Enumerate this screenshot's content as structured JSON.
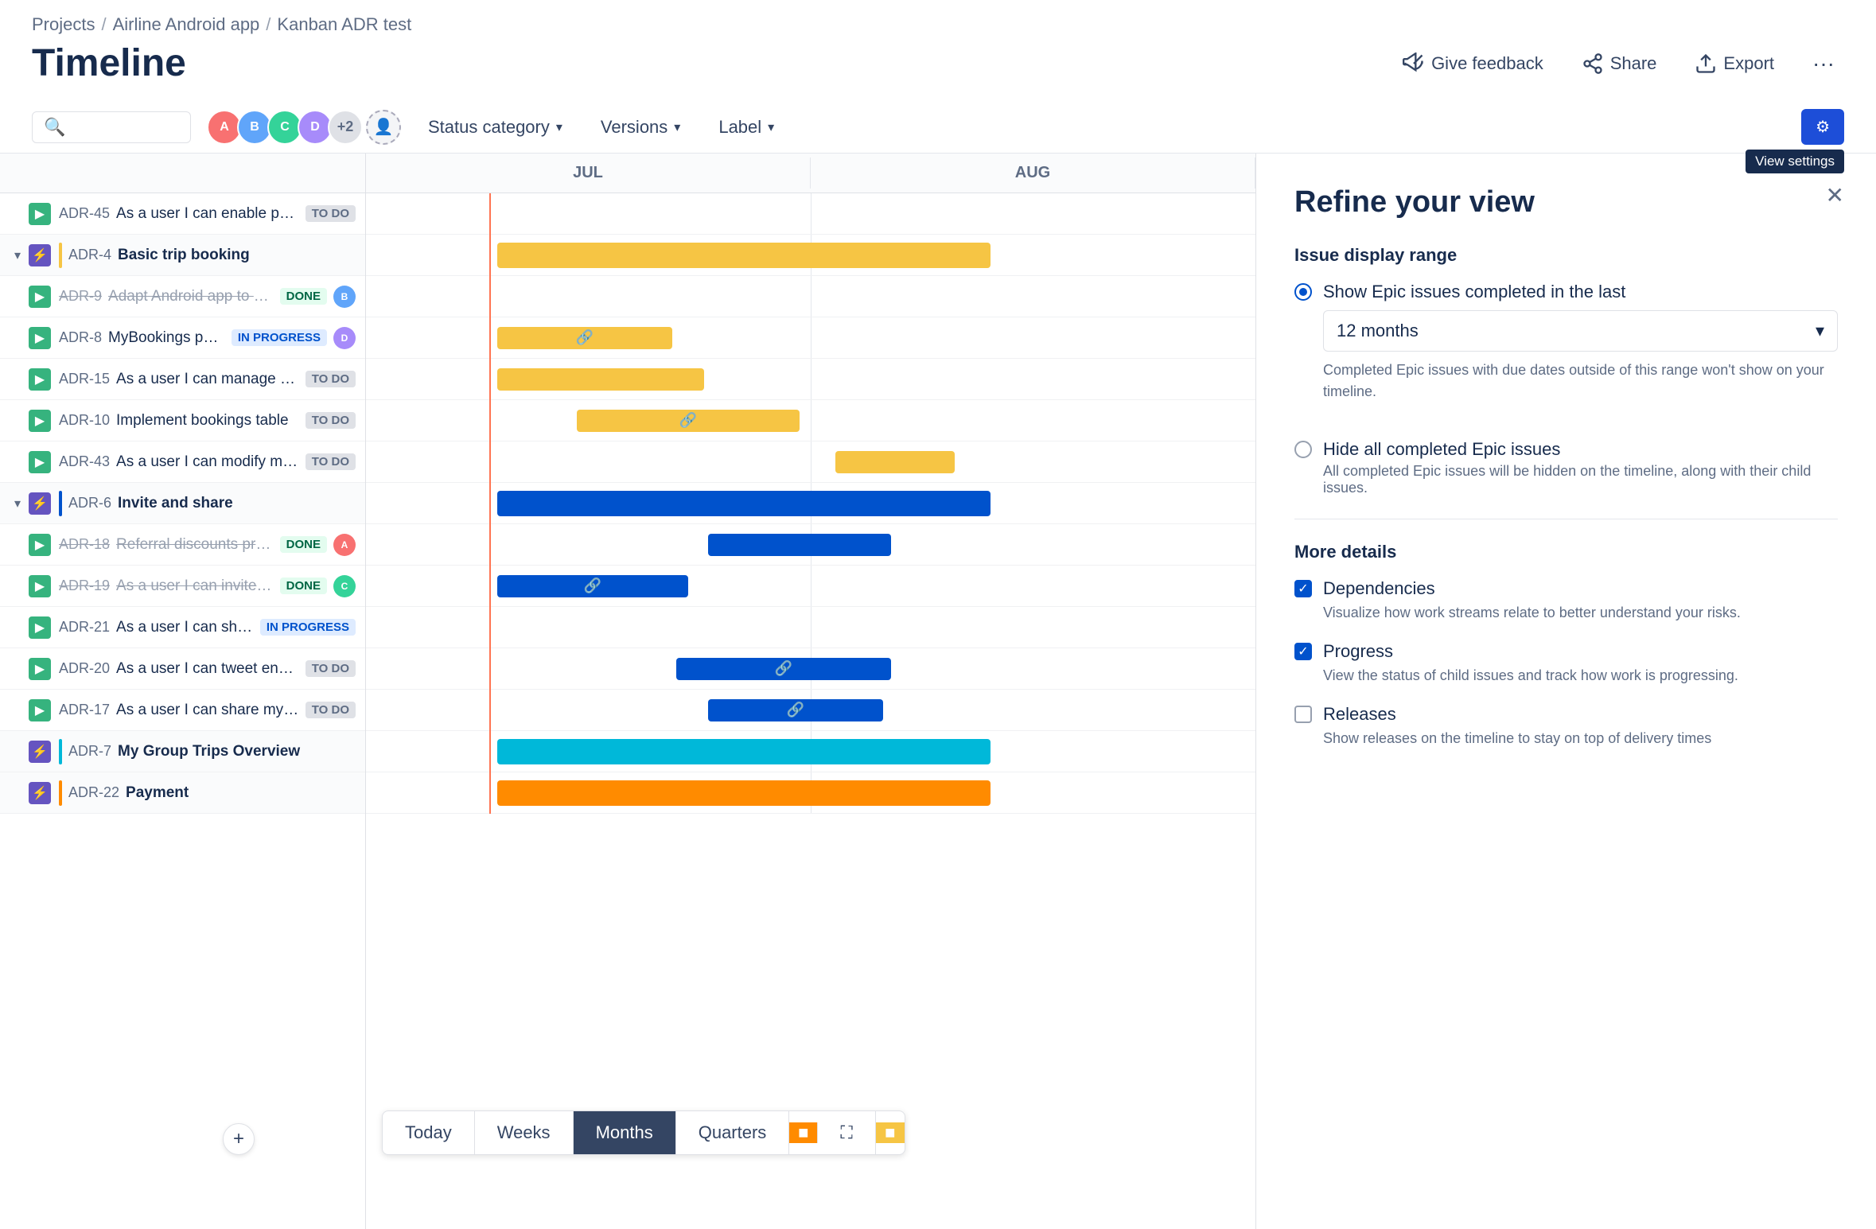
{
  "breadcrumb": {
    "items": [
      "Projects",
      "Airline Android app",
      "Kanban ADR test"
    ],
    "separators": [
      "/",
      "/"
    ]
  },
  "page": {
    "title": "Timeline"
  },
  "header_actions": {
    "feedback_label": "Give feedback",
    "share_label": "Share",
    "export_label": "Export"
  },
  "toolbar": {
    "search_placeholder": "",
    "status_category_label": "Status category",
    "versions_label": "Versions",
    "label_label": "Label",
    "view_settings_label": "View settings",
    "avatars": [
      {
        "initials": "A",
        "color": "#f87171"
      },
      {
        "initials": "B",
        "color": "#60a5fa"
      },
      {
        "initials": "C",
        "color": "#34d399"
      },
      {
        "initials": "D",
        "color": "#a78bfa"
      },
      {
        "extra": "+2"
      }
    ]
  },
  "gantt": {
    "months": [
      "JUL",
      "AUG"
    ],
    "rows": [
      {
        "id": "ADR-45",
        "name": "As a user I can enable pus...",
        "type": "story",
        "status": "TO DO",
        "indent": 1,
        "strikethrough": false
      },
      {
        "id": "ADR-4",
        "name": "Basic trip booking",
        "type": "epic",
        "status": "",
        "indent": 0,
        "collapsed": false,
        "epicColor": "#f6c544"
      },
      {
        "id": "ADR-9",
        "name": "Adapt Android app to ne...",
        "type": "story",
        "status": "DONE",
        "indent": 1,
        "strikethrough": true
      },
      {
        "id": "ADR-8",
        "name": "MyBookings page",
        "type": "story",
        "status": "IN PROGRESS",
        "indent": 1,
        "strikethrough": false
      },
      {
        "id": "ADR-15",
        "name": "As a user I can manage my ...",
        "type": "story",
        "status": "TO DO",
        "indent": 1,
        "strikethrough": false
      },
      {
        "id": "ADR-10",
        "name": "Implement bookings table",
        "type": "story",
        "status": "TO DO",
        "indent": 1,
        "strikethrough": false
      },
      {
        "id": "ADR-43",
        "name": "As a user I can modify my ...",
        "type": "story",
        "status": "TO DO",
        "indent": 1,
        "strikethrough": false
      },
      {
        "id": "ADR-6",
        "name": "Invite and share",
        "type": "epic",
        "status": "",
        "indent": 0,
        "collapsed": false,
        "epicColor": "#0052cc"
      },
      {
        "id": "ADR-18",
        "name": "Referral discounts proc...",
        "type": "story",
        "status": "DONE",
        "indent": 1,
        "strikethrough": true
      },
      {
        "id": "ADR-19",
        "name": "As a user I can invite fri...",
        "type": "story",
        "status": "DONE",
        "indent": 1,
        "strikethrough": true
      },
      {
        "id": "ADR-21",
        "name": "As a user I can share ...",
        "type": "story",
        "status": "IN PROGRESS",
        "indent": 1,
        "strikethrough": false
      },
      {
        "id": "ADR-20",
        "name": "As a user I can tweet endle...",
        "type": "story",
        "status": "TO DO",
        "indent": 1,
        "strikethrough": false
      },
      {
        "id": "ADR-17",
        "name": "As a user I can share my up...",
        "type": "story",
        "status": "TO DO",
        "indent": 1,
        "strikethrough": false
      },
      {
        "id": "ADR-7",
        "name": "My Group Trips Overview",
        "type": "epic",
        "status": "",
        "indent": 0,
        "epicColor": "#00b8d9"
      },
      {
        "id": "ADR-22",
        "name": "Payment",
        "type": "epic",
        "status": "",
        "indent": 0,
        "epicColor": "#ff8b00"
      }
    ]
  },
  "panel": {
    "title": "Refine your view",
    "issue_display_range_label": "Issue display range",
    "show_epic_label": "Show Epic issues completed in the last",
    "show_epic_dropdown": "12 months",
    "show_epic_note": "Completed Epic issues with due dates outside of this range won't show on your timeline.",
    "hide_epic_label": "Hide all completed Epic issues",
    "hide_epic_note": "All completed Epic issues will be hidden on the timeline, along with their child issues.",
    "more_details_label": "More details",
    "dependencies_label": "Dependencies",
    "dependencies_note": "Visualize how work streams relate to better understand your risks.",
    "progress_label": "Progress",
    "progress_note": "View the status of child issues and track how work is progressing.",
    "releases_label": "Releases",
    "releases_note": "Show releases on the timeline to stay on top of delivery times"
  },
  "bottom_bar": {
    "today_label": "Today",
    "weeks_label": "Weeks",
    "months_label": "Months",
    "quarters_label": "Quarters"
  }
}
